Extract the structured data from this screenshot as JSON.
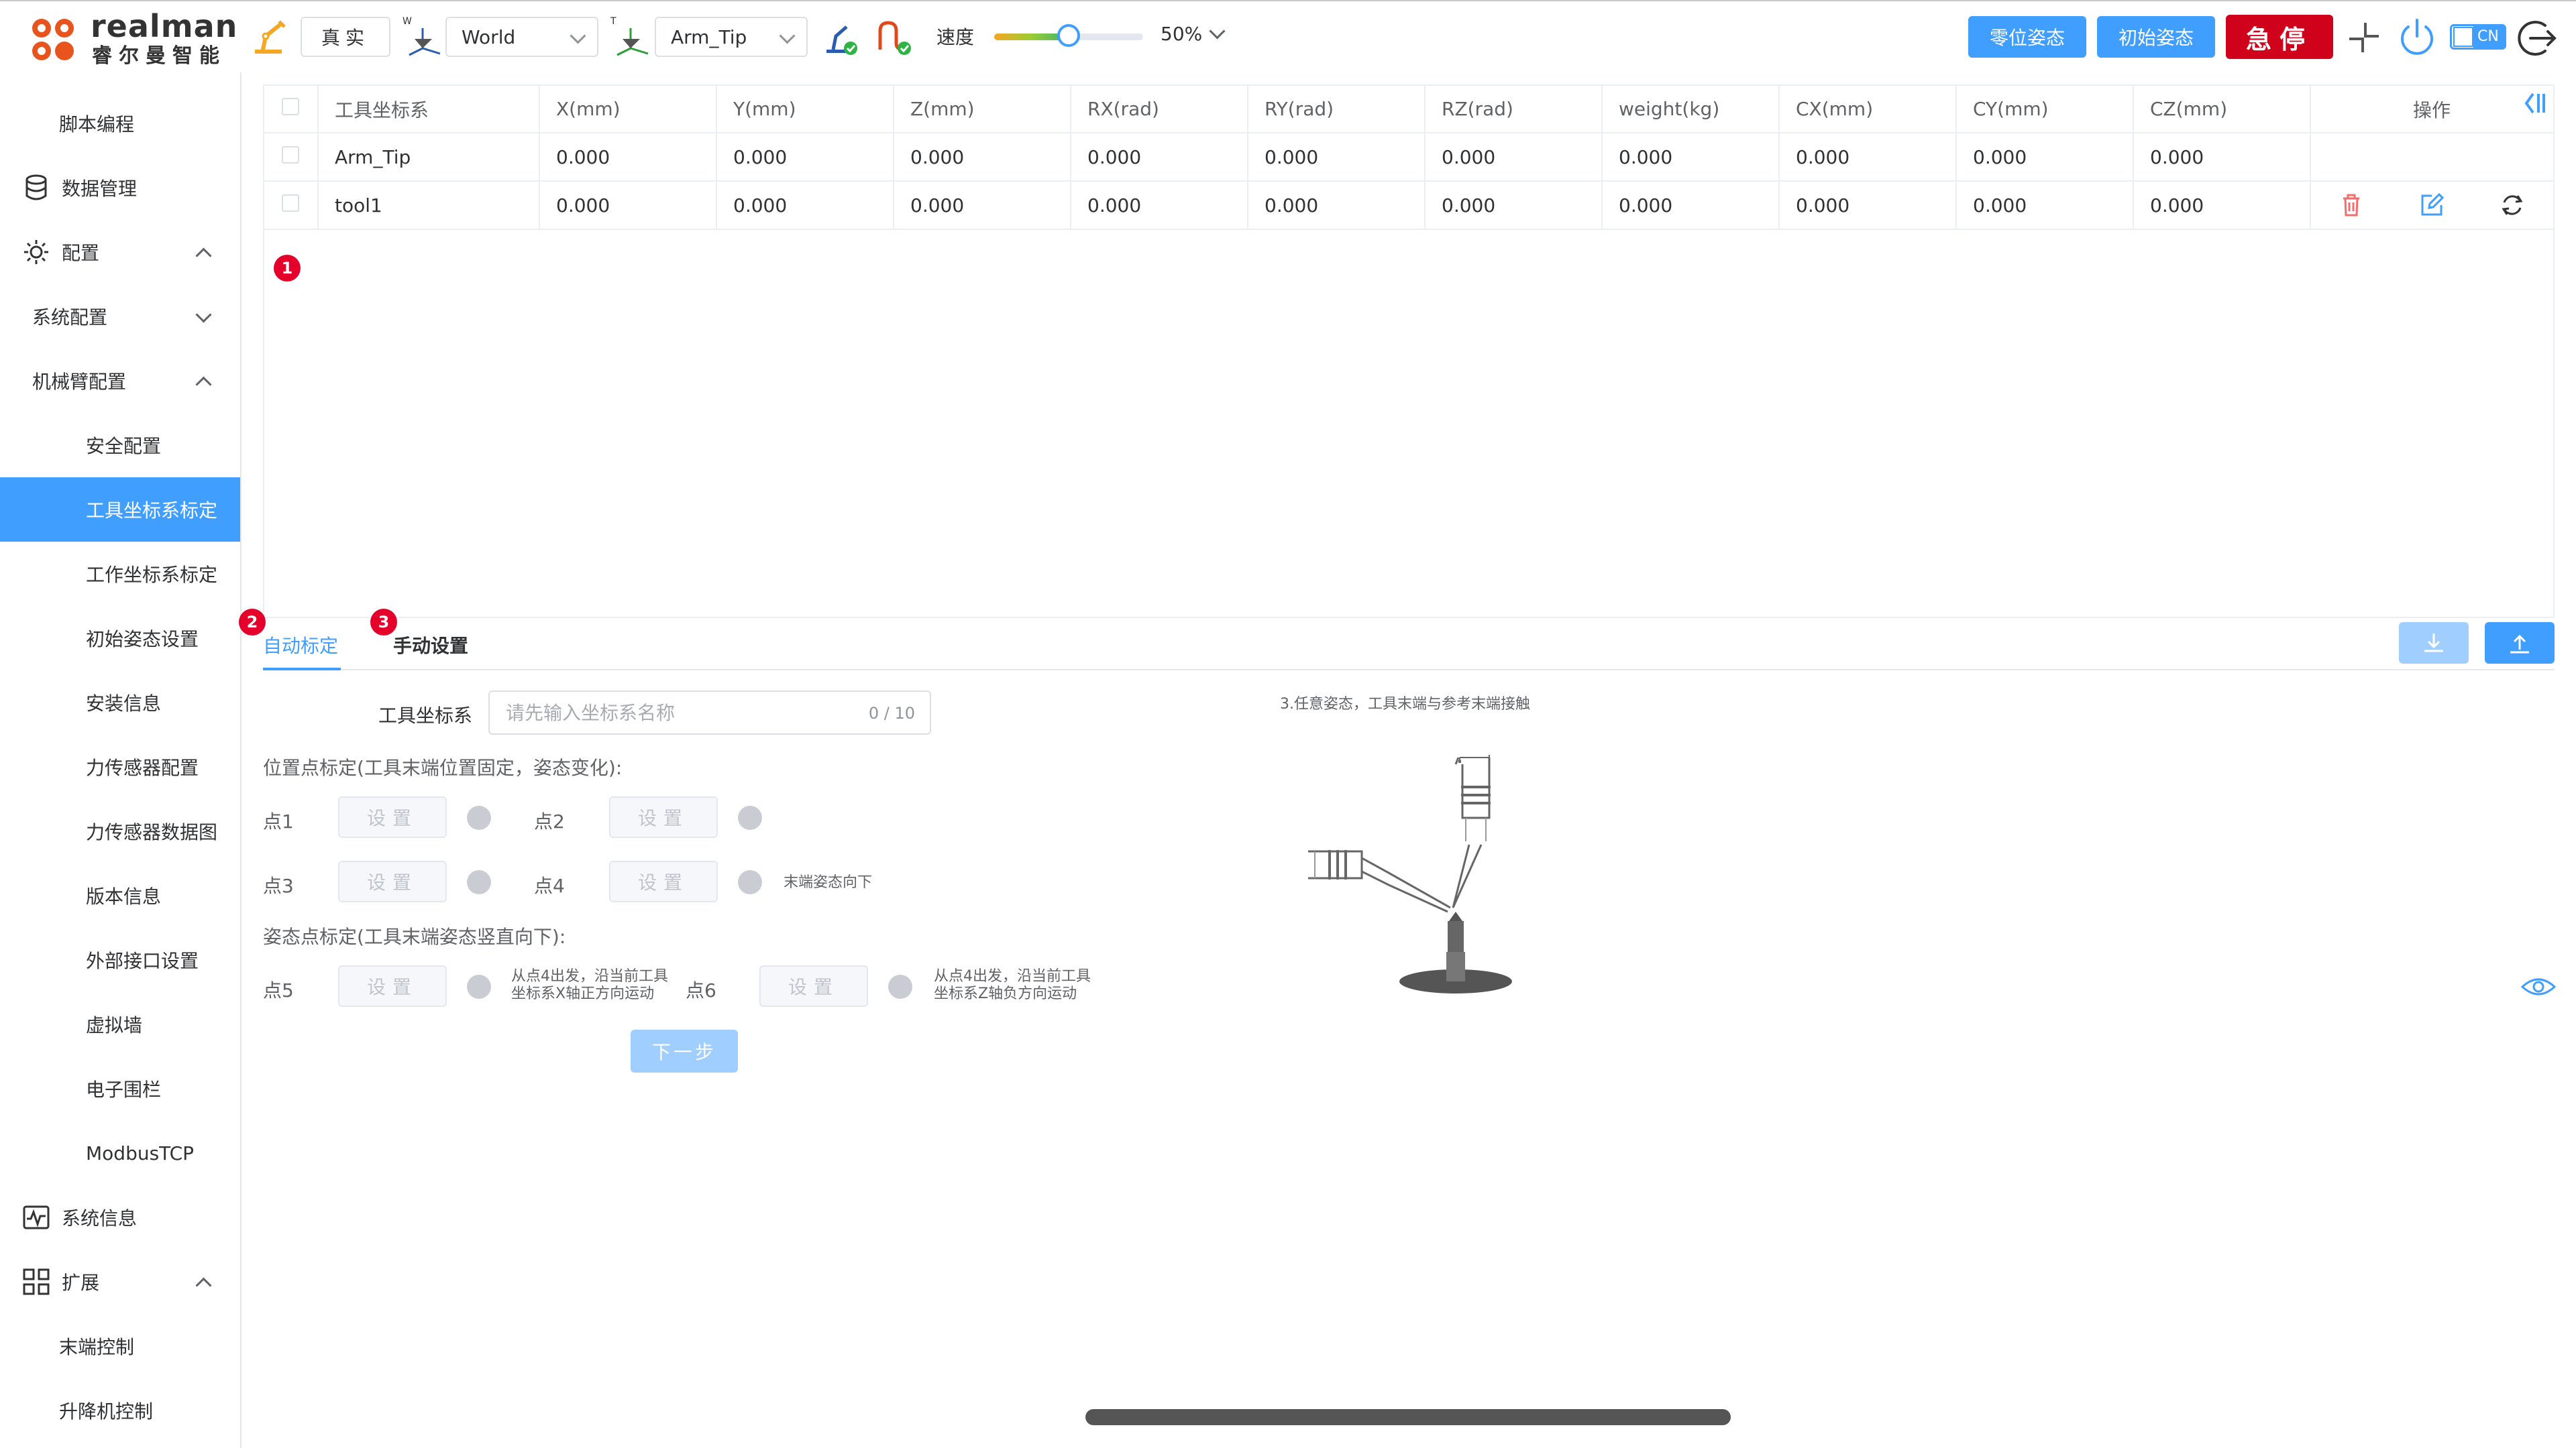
{
  "brand": {
    "name_en": "realman",
    "name_cn": "睿尔曼智能"
  },
  "toolbar": {
    "mode": "真实",
    "frame_select": "World",
    "tool_select": "Arm_Tip",
    "speed_label": "速度",
    "speed_value": "50%",
    "speed_fraction": 0.5,
    "zero_pose": "零位姿态",
    "init_pose": "初始姿态",
    "estop": "急停",
    "lang": "CN"
  },
  "sidebar": {
    "items": [
      {
        "label": "脚本编程"
      },
      {
        "label": "数据管理"
      },
      {
        "label": "配置"
      },
      {
        "label": "系统配置"
      },
      {
        "label": "机械臂配置"
      },
      {
        "label": "安全配置"
      },
      {
        "label": "工具坐标系标定"
      },
      {
        "label": "工作坐标系标定"
      },
      {
        "label": "初始姿态设置"
      },
      {
        "label": "安装信息"
      },
      {
        "label": "力传感器配置"
      },
      {
        "label": "力传感器数据图"
      },
      {
        "label": "版本信息"
      },
      {
        "label": "外部接口设置"
      },
      {
        "label": "虚拟墙"
      },
      {
        "label": "电子围栏"
      },
      {
        "label": "ModbusTCP"
      },
      {
        "label": "系统信息"
      },
      {
        "label": "扩展"
      },
      {
        "label": "末端控制"
      },
      {
        "label": "升降机控制"
      }
    ]
  },
  "table": {
    "headers": [
      "工具坐标系",
      "X(mm)",
      "Y(mm)",
      "Z(mm)",
      "RX(rad)",
      "RY(rad)",
      "RZ(rad)",
      "weight(kg)",
      "CX(mm)",
      "CY(mm)",
      "CZ(mm)",
      "操作"
    ],
    "rows": [
      [
        "Arm_Tip",
        "0.000",
        "0.000",
        "0.000",
        "0.000",
        "0.000",
        "0.000",
        "0.000",
        "0.000",
        "0.000",
        "0.000"
      ],
      [
        "tool1",
        "0.000",
        "0.000",
        "0.000",
        "0.000",
        "0.000",
        "0.000",
        "0.000",
        "0.000",
        "0.000",
        "0.000"
      ]
    ]
  },
  "badges": [
    "1",
    "2",
    "3"
  ],
  "tabs": {
    "auto": "自动标定",
    "manual": "手动设置"
  },
  "form": {
    "tool_frame_label": "工具坐标系",
    "name_placeholder": "请先输入坐标系名称",
    "name_count": "0 / 10",
    "position_section": "位置点标定(工具末端位置固定，姿态变化):",
    "pose_section": "姿态点标定(工具末端姿态竖直向下):",
    "points": [
      "点1",
      "点2",
      "点3",
      "点4",
      "点5",
      "点6"
    ],
    "set_label": "设置",
    "note_p4": "末端姿态向下",
    "note_p5": [
      "从点4出发，沿当前工具",
      "坐标系X轴正方向运动"
    ],
    "note_p6": [
      "从点4出发，沿当前工具",
      "坐标系Z轴负方向运动"
    ],
    "next": "下一步"
  },
  "illustration": {
    "caption": "3.任意姿态，工具末端与参考末端接触"
  },
  "colors": {
    "primary": "#409eff",
    "danger": "#d0021b",
    "badge": "#e4002b"
  }
}
